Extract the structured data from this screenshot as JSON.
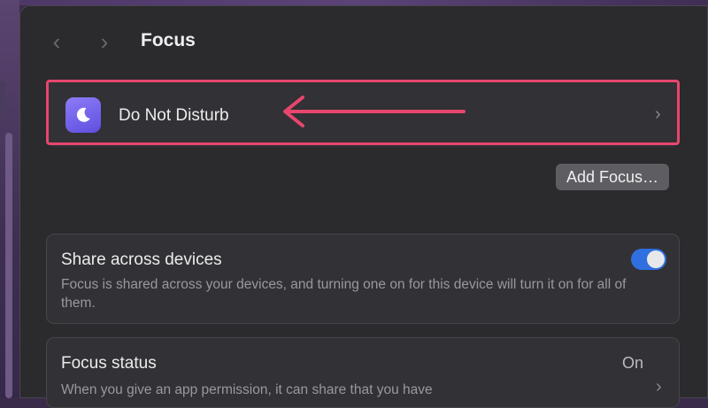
{
  "window": {
    "title": "Focus",
    "nav": {
      "back_icon": "chevron-left-icon",
      "forward_icon": "chevron-right-icon"
    }
  },
  "focus_list": {
    "items": [
      {
        "label": "Do Not Disturb",
        "icon": "moon-icon",
        "accent": "#7a6af0"
      }
    ],
    "highlight_color": "#e8466e"
  },
  "add_focus": {
    "label": "Add Focus…"
  },
  "share_across_devices": {
    "title": "Share across devices",
    "description": "Focus is shared across your devices, and turning one on for this device will turn it on for all of them.",
    "toggle_on": true,
    "toggle_color": "#2f6fe0"
  },
  "focus_status": {
    "title": "Focus status",
    "value": "On",
    "description": "When you give an app permission, it can share that you have"
  }
}
